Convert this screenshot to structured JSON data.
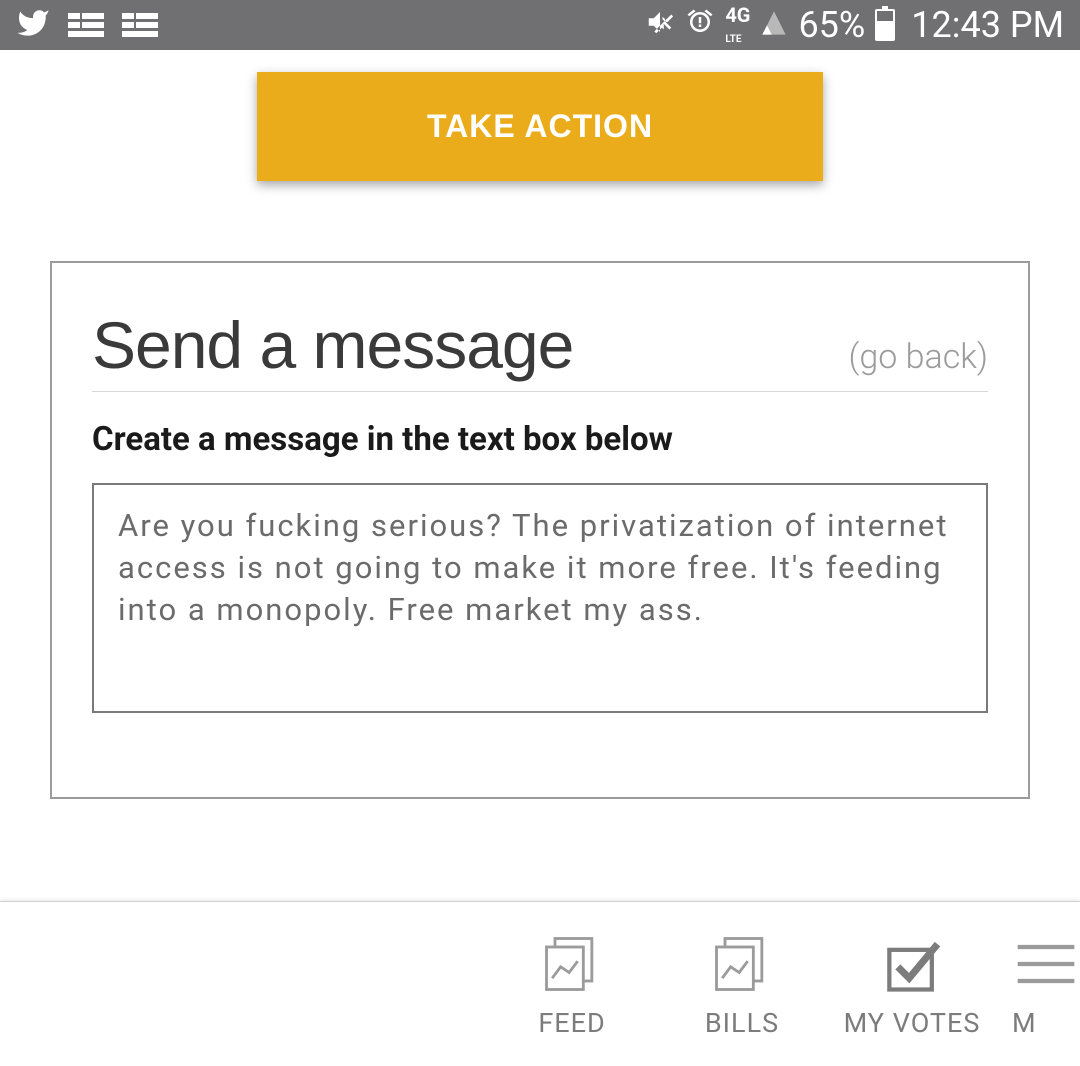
{
  "status_bar": {
    "battery_pct": "65%",
    "clock": "12:43 PM",
    "network": "4G LTE"
  },
  "header": {
    "take_action": "TAKE ACTION"
  },
  "panel": {
    "title": "Send a message",
    "go_back": "(go back)",
    "instruction": "Create a message in the text box below",
    "message_value": "Are you fucking serious? The privatization of internet access is not going to make it more free. It's feeding into a monopoly. Free market my ass."
  },
  "nav": {
    "feed": "FEED",
    "bills": "BILLS",
    "my_votes": "MY VOTES",
    "more": "M"
  }
}
